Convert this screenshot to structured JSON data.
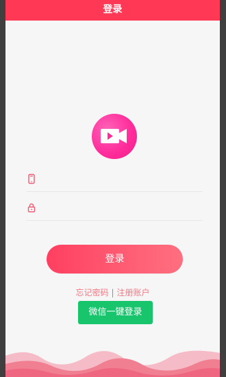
{
  "header": {
    "title": "登录"
  },
  "logo": {
    "icon": "video-camera-icon"
  },
  "form": {
    "phone_icon": "phone-icon",
    "password_icon": "lock-icon",
    "phone_placeholder": "",
    "password_placeholder": ""
  },
  "actions": {
    "login_label": "登录",
    "forgot_password": "忘记密码",
    "separator": "|",
    "register": "注册账户",
    "wechat_login": "微信一键登录"
  },
  "colors": {
    "header": "#ff3855",
    "accent": "#ff3f61",
    "wechat": "#18c46c",
    "logo": "#ff2c9b",
    "link": "#f07a86"
  }
}
